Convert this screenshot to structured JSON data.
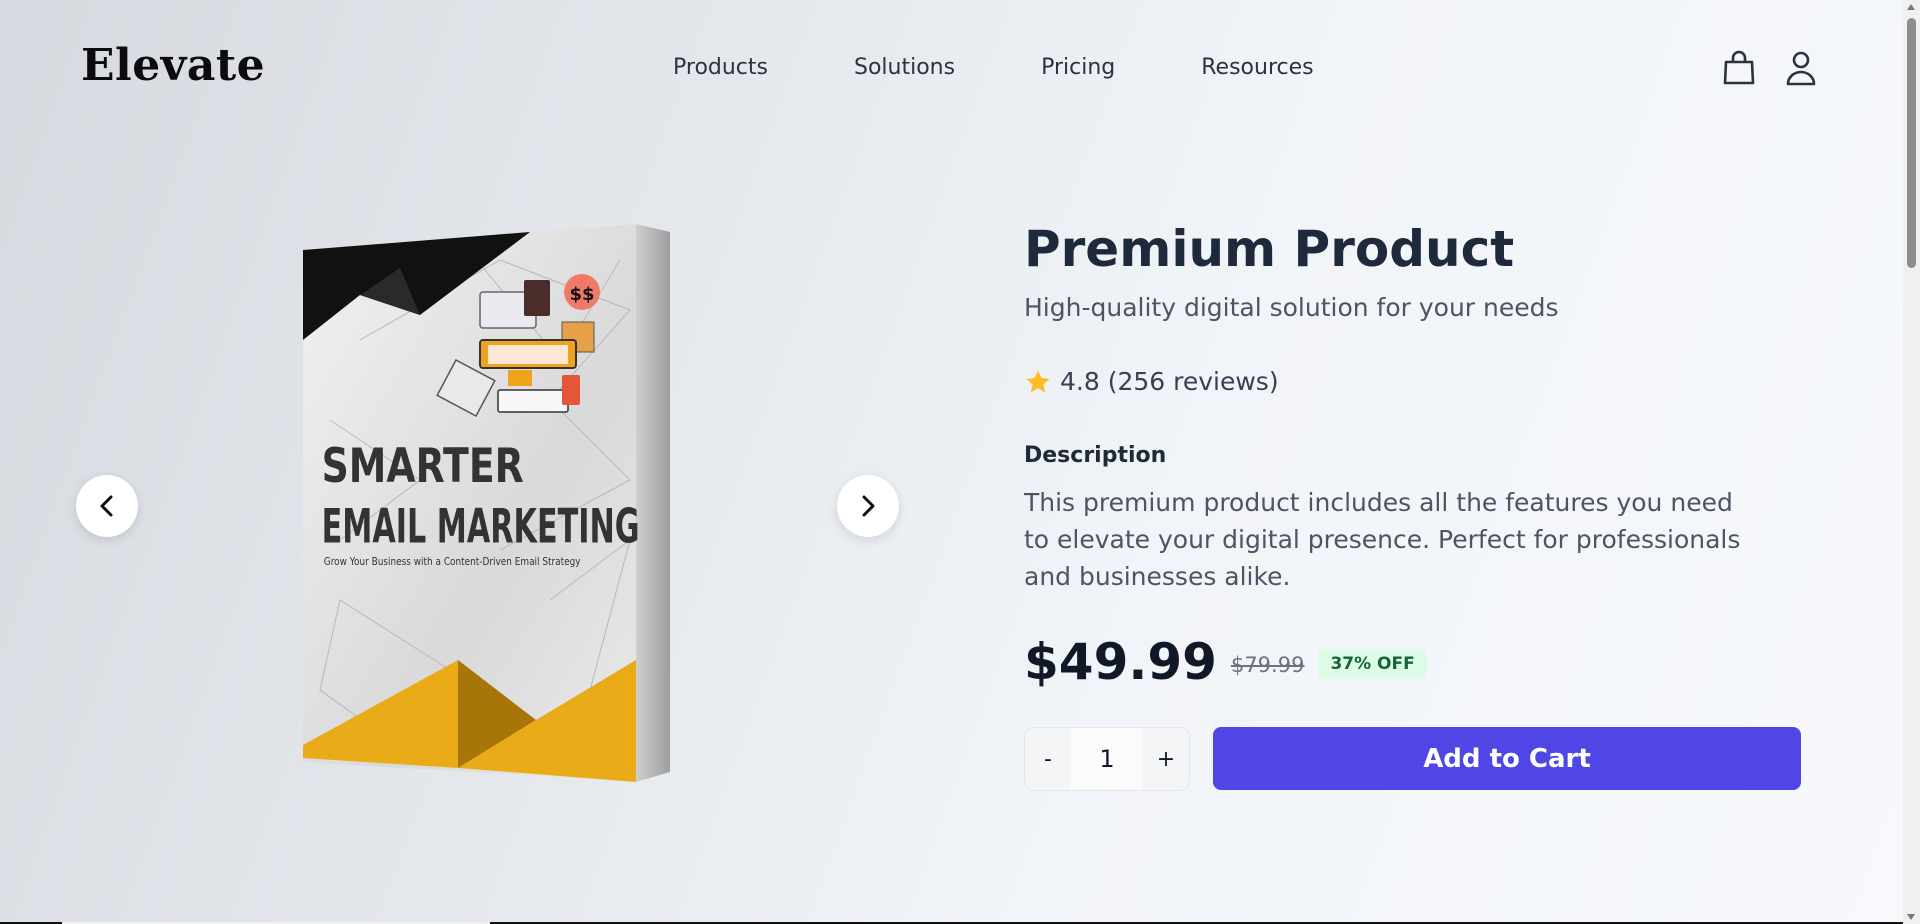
{
  "header": {
    "logo": "Elevate",
    "nav": [
      "Products",
      "Solutions",
      "Pricing",
      "Resources"
    ],
    "icons": [
      "shopping-bag-icon",
      "user-icon"
    ]
  },
  "gallery": {
    "book": {
      "title_line1": "SMARTER",
      "title_line2": "EMAIL MARKETING",
      "subtitle": "Grow Your Business with a Content-Driven Email Strategy",
      "badge": "$$"
    },
    "icons": [
      "chevron-left-icon",
      "chevron-right-icon"
    ]
  },
  "product": {
    "title": "Premium Product",
    "subtitle": "High-quality digital solution for your needs",
    "rating": 4.8,
    "rating_text": "4.8 (256 reviews)",
    "description_label": "Description",
    "description": "This premium product includes all the features you need to elevate your digital presence. Perfect for professionals and businesses alike.",
    "price": "$49.99",
    "old_price": "$79.99",
    "discount": "37% OFF",
    "quantity": {
      "minus": "-",
      "value": "1",
      "plus": "+"
    },
    "add_to_cart": "Add to Cart"
  },
  "colors": {
    "accent": "#4f46e5",
    "star": "#fbbf24",
    "discount_bg": "#dcfce7",
    "discount_text": "#166534",
    "book_yellow": "#e9ab17",
    "book_black": "#111111"
  }
}
